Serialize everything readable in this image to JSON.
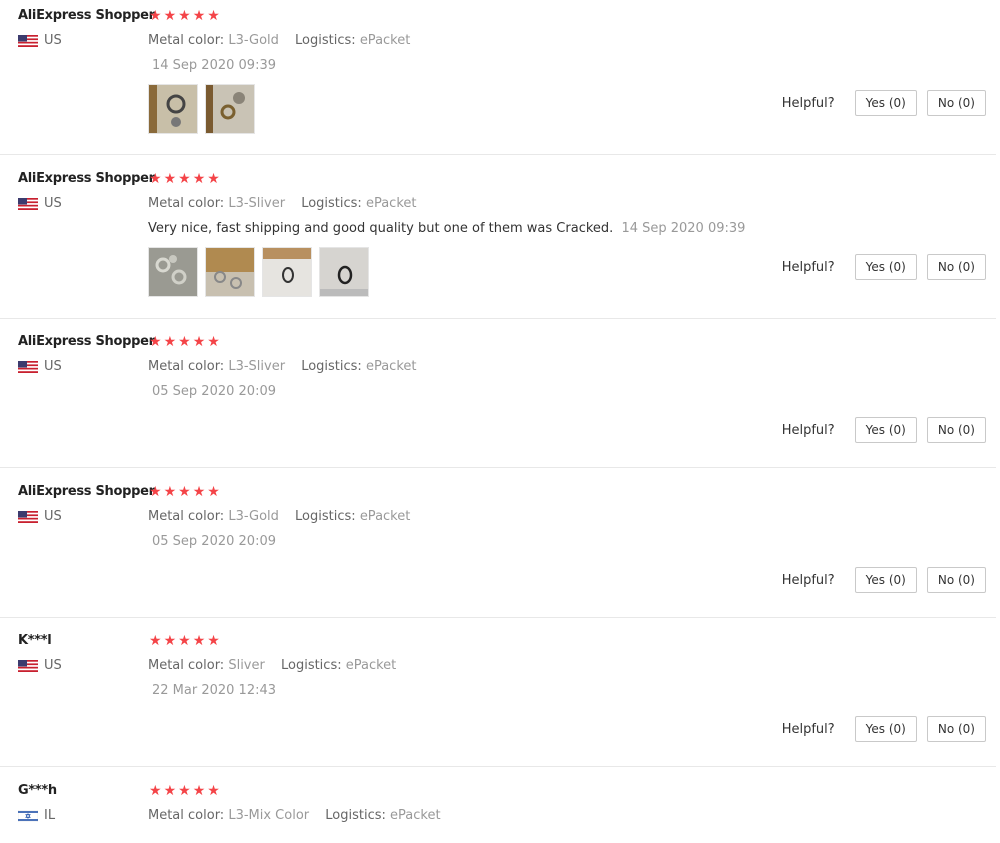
{
  "helpful_label": "Helpful?",
  "metal_key": "Metal color:",
  "logistics_key": "Logistics:",
  "star_color": "#f44448",
  "reviews": [
    {
      "user": "AliExpress Shopper",
      "country": "US",
      "flag_icon": "us-flag-icon",
      "rating": 5,
      "metal_color": "L3-Gold",
      "logistics": "ePacket",
      "date": "14 Sep 2020 09:39",
      "yes": "Yes (0)",
      "no": "No (0)",
      "photo_count": 2
    },
    {
      "user": "AliExpress Shopper",
      "country": "US",
      "flag_icon": "us-flag-icon",
      "rating": 5,
      "metal_color": "L3-Sliver",
      "logistics": "ePacket",
      "content": "Very nice, fast shipping and good quality but one of them was Cracked.",
      "date": "14 Sep 2020 09:39",
      "yes": "Yes (0)",
      "no": "No (0)",
      "photo_count": 4
    },
    {
      "user": "AliExpress Shopper",
      "country": "US",
      "flag_icon": "us-flag-icon",
      "rating": 5,
      "metal_color": "L3-Sliver",
      "logistics": "ePacket",
      "date": "05 Sep 2020 20:09",
      "yes": "Yes (0)",
      "no": "No (0)",
      "photo_count": 0
    },
    {
      "user": "AliExpress Shopper",
      "country": "US",
      "flag_icon": "us-flag-icon",
      "rating": 5,
      "metal_color": "L3-Gold",
      "logistics": "ePacket",
      "date": "05 Sep 2020 20:09",
      "yes": "Yes (0)",
      "no": "No (0)",
      "photo_count": 0
    },
    {
      "user": "K***l",
      "country": "US",
      "flag_icon": "us-flag-icon",
      "rating": 5,
      "metal_color": "Sliver",
      "logistics": "ePacket",
      "date": "22 Mar 2020 12:43",
      "yes": "Yes (0)",
      "no": "No (0)",
      "photo_count": 0
    },
    {
      "user": "G***h",
      "country": "IL",
      "flag_icon": "il-flag-icon",
      "rating": 5,
      "metal_color": "L3-Mix Color",
      "logistics": "ePacket"
    }
  ]
}
